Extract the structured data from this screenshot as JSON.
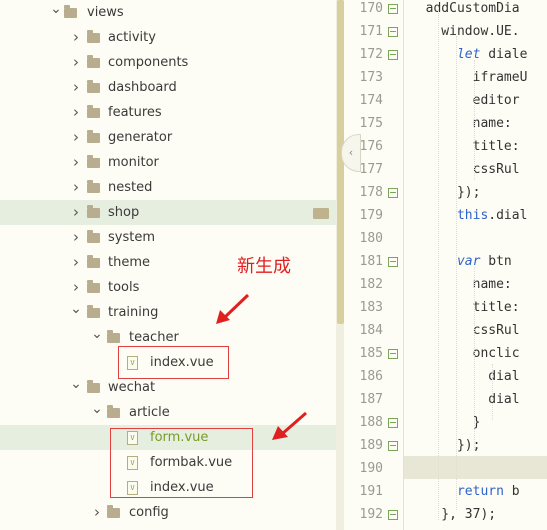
{
  "tree": {
    "rows": [
      {
        "label": "views",
        "indent": 0,
        "expanded": true,
        "kind": "folder"
      },
      {
        "label": "activity",
        "indent": 1,
        "expanded": false,
        "kind": "folder"
      },
      {
        "label": "components",
        "indent": 1,
        "expanded": false,
        "kind": "folder"
      },
      {
        "label": "dashboard",
        "indent": 1,
        "expanded": false,
        "kind": "folder"
      },
      {
        "label": "features",
        "indent": 1,
        "expanded": false,
        "kind": "folder"
      },
      {
        "label": "generator",
        "indent": 1,
        "expanded": false,
        "kind": "folder"
      },
      {
        "label": "monitor",
        "indent": 1,
        "expanded": false,
        "kind": "folder"
      },
      {
        "label": "nested",
        "indent": 1,
        "expanded": false,
        "kind": "folder"
      },
      {
        "label": "shop",
        "indent": 1,
        "expanded": false,
        "kind": "folder",
        "selected": true
      },
      {
        "label": "system",
        "indent": 1,
        "expanded": false,
        "kind": "folder"
      },
      {
        "label": "theme",
        "indent": 1,
        "expanded": false,
        "kind": "folder"
      },
      {
        "label": "tools",
        "indent": 1,
        "expanded": false,
        "kind": "folder"
      },
      {
        "label": "training",
        "indent": 1,
        "expanded": true,
        "kind": "folder"
      },
      {
        "label": "teacher",
        "indent": 2,
        "expanded": true,
        "kind": "folder"
      },
      {
        "label": "index.vue",
        "indent": 3,
        "kind": "file"
      },
      {
        "label": "wechat",
        "indent": 1,
        "expanded": true,
        "kind": "folder"
      },
      {
        "label": "article",
        "indent": 2,
        "expanded": true,
        "kind": "folder"
      },
      {
        "label": "form.vue",
        "indent": 3,
        "kind": "file",
        "selected": true,
        "highlight": true
      },
      {
        "label": "formbak.vue",
        "indent": 3,
        "kind": "file"
      },
      {
        "label": "index.vue",
        "indent": 3,
        "kind": "file"
      },
      {
        "label": "config",
        "indent": 2,
        "expanded": false,
        "kind": "folder"
      }
    ],
    "file_icon_letter": "V"
  },
  "annotation": {
    "text": "新生成",
    "color": "#e02020"
  },
  "editor": {
    "lines": [
      {
        "n": "170",
        "fold": true,
        "code": [
          [
            "t",
            "  addCustomDia"
          ]
        ]
      },
      {
        "n": "171",
        "fold": true,
        "code": [
          [
            "t",
            "    window.UE."
          ]
        ]
      },
      {
        "n": "172",
        "fold": true,
        "code": [
          [
            "k",
            "      let"
          ],
          [
            "t",
            " diale"
          ]
        ]
      },
      {
        "n": "173",
        "fold": false,
        "code": [
          [
            "t",
            "        iframeU"
          ]
        ]
      },
      {
        "n": "174",
        "fold": false,
        "code": [
          [
            "t",
            "        editor"
          ]
        ]
      },
      {
        "n": "175",
        "fold": false,
        "code": [
          [
            "t",
            "        name:"
          ]
        ]
      },
      {
        "n": "176",
        "fold": false,
        "code": [
          [
            "t",
            "        title:"
          ]
        ]
      },
      {
        "n": "177",
        "fold": false,
        "code": [
          [
            "t",
            "        cssRul"
          ]
        ]
      },
      {
        "n": "178",
        "fold": true,
        "code": [
          [
            "t",
            "      });"
          ]
        ]
      },
      {
        "n": "179",
        "fold": false,
        "code": [
          [
            "f",
            "      this"
          ],
          [
            "t",
            ".dial"
          ]
        ]
      },
      {
        "n": "180",
        "fold": false,
        "code": [
          [
            "t",
            ""
          ]
        ]
      },
      {
        "n": "181",
        "fold": true,
        "code": [
          [
            "k",
            "      var"
          ],
          [
            "t",
            " btn"
          ]
        ]
      },
      {
        "n": "182",
        "fold": false,
        "code": [
          [
            "t",
            "        name:"
          ]
        ]
      },
      {
        "n": "183",
        "fold": false,
        "code": [
          [
            "t",
            "        title:"
          ]
        ]
      },
      {
        "n": "184",
        "fold": false,
        "code": [
          [
            "t",
            "        cssRul"
          ]
        ]
      },
      {
        "n": "185",
        "fold": true,
        "code": [
          [
            "t",
            "        onclic"
          ]
        ]
      },
      {
        "n": "186",
        "fold": false,
        "code": [
          [
            "t",
            "          dial"
          ]
        ]
      },
      {
        "n": "187",
        "fold": false,
        "code": [
          [
            "t",
            "          dial"
          ]
        ]
      },
      {
        "n": "188",
        "fold": true,
        "code": [
          [
            "t",
            "        }"
          ]
        ]
      },
      {
        "n": "189",
        "fold": true,
        "code": [
          [
            "t",
            "      });"
          ]
        ]
      },
      {
        "n": "190",
        "fold": false,
        "code": [
          [
            "t",
            ""
          ]
        ]
      },
      {
        "n": "191",
        "fold": false,
        "code": [
          [
            "f",
            "      return"
          ],
          [
            "t",
            " b"
          ]
        ]
      },
      {
        "n": "192",
        "fold": true,
        "code": [
          [
            "t",
            "    }, 37);"
          ]
        ]
      }
    ]
  }
}
